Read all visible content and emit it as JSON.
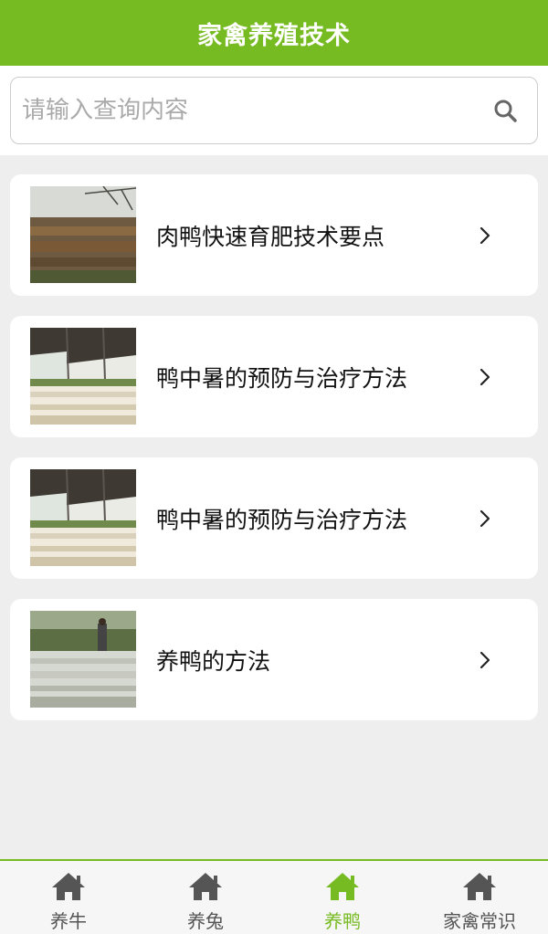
{
  "header": {
    "title": "家禽养殖技术"
  },
  "search": {
    "placeholder": "请输入查询内容",
    "value": ""
  },
  "articles": [
    {
      "title": "肉鸭快速育肥技术要点",
      "thumbnail": "duck-farm-field-photo"
    },
    {
      "title": "鸭中暑的预防与治疗方法",
      "thumbnail": "duck-barn-photo"
    },
    {
      "title": "鸭中暑的预防与治疗方法",
      "thumbnail": "duck-barn-photo"
    },
    {
      "title": "养鸭的方法",
      "thumbnail": "duck-flock-photo"
    }
  ],
  "nav": {
    "items": [
      {
        "label": "养牛",
        "icon": "home-icon",
        "active": false
      },
      {
        "label": "养兔",
        "icon": "home-icon",
        "active": false
      },
      {
        "label": "养鸭",
        "icon": "home-icon",
        "active": true
      },
      {
        "label": "家禽常识",
        "icon": "home-icon",
        "active": false
      }
    ]
  },
  "colors": {
    "accent": "#77bb22",
    "nav_inactive": "#555555",
    "text": "#111111"
  }
}
